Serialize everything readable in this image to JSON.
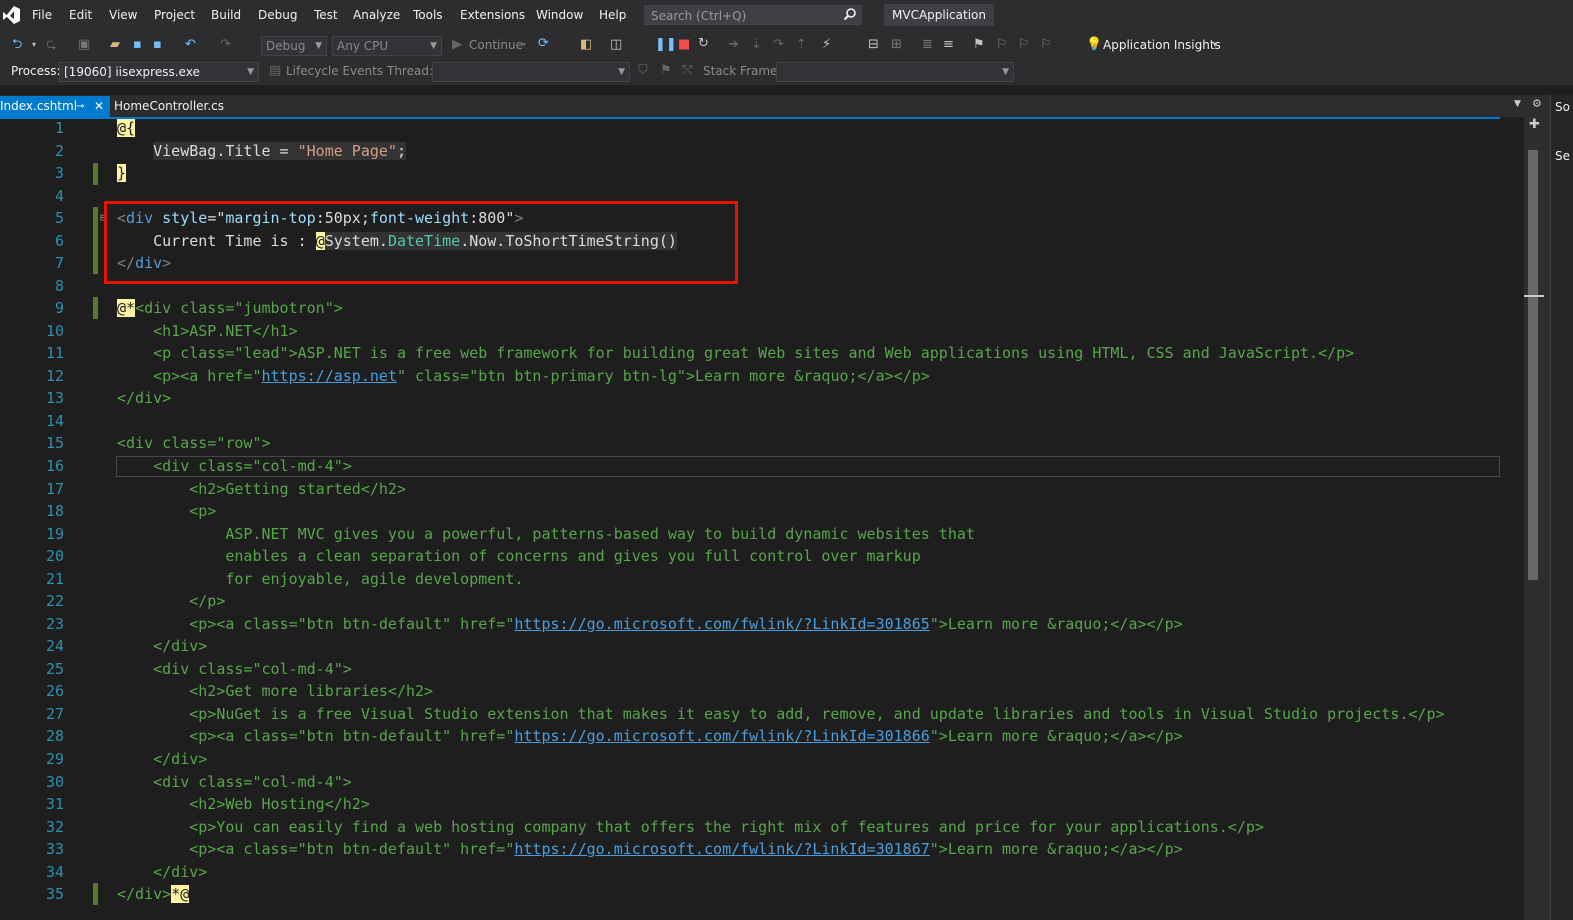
{
  "menu": [
    "File",
    "Edit",
    "View",
    "Project",
    "Build",
    "Debug",
    "Test",
    "Analyze",
    "Tools",
    "Extensions",
    "Window",
    "Help"
  ],
  "search": {
    "placeholder": "Search (Ctrl+Q)"
  },
  "app_title": "MVCApplication",
  "toolbar": {
    "config": "Debug",
    "platform": "Any CPU",
    "continue_label": "Continue",
    "app_insights": "Application Insights",
    "process_label": "Process:",
    "process_value": "[19060] iisexpress.exe",
    "lifecycle_label": "Lifecycle Events",
    "thread_label": "Thread:",
    "stack_frame_label": "Stack Frame:"
  },
  "tabs": {
    "active": "Index.cshtml",
    "inactive": "HomeController.cs"
  },
  "right_panel": {
    "top_label": "So",
    "second_label": "Se"
  },
  "editor": {
    "line_numbers": [
      "1",
      "2",
      "3",
      "4",
      "5",
      "6",
      "7",
      "8",
      "9",
      "10",
      "11",
      "12",
      "13",
      "14",
      "15",
      "16",
      "17",
      "18",
      "19",
      "20",
      "21",
      "22",
      "23",
      "24",
      "25",
      "26",
      "27",
      "28",
      "29",
      "30",
      "31",
      "32",
      "33",
      "34",
      "35"
    ],
    "t": {
      "l1a": "@",
      "l1b": "{",
      "l2a": "ViewBag.Title = ",
      "l2b": "\"Home Page\"",
      "l2c": ";",
      "l3": "}",
      "l5a": "<",
      "l5b": "div",
      "l5c": " style",
      "l5d": "=\"",
      "l5e": "margin-top",
      "l5f": ":50px;",
      "l5g": "font-weight",
      "l5h": ":800\"",
      "l5i": ">",
      "l6a": "Current Time is : ",
      "l6b": "@",
      "l6c": "System.",
      "l6d": "DateTime",
      "l6e": ".Now.ToShortTimeString()",
      "l7a": "</",
      "l7b": "div",
      "l7c": ">",
      "l9a": "@*",
      "l9b": "<div class=\"jumbotron\">",
      "l10": "    <h1>ASP.NET</h1>",
      "l11": "    <p class=\"lead\">ASP.NET is a free web framework for building great Web sites and Web applications using HTML, CSS and JavaScript.</p>",
      "l12a": "    <p><a href=\"",
      "l12b": "https://asp.net",
      "l12c": "\" class=\"btn btn-primary btn-lg\">Learn more &raquo;</a></p>",
      "l13": "</div>",
      "l15": "<div class=\"row\">",
      "l16": "    <div class=\"col-md-4\">",
      "l17": "        <h2>Getting started</h2>",
      "l18": "        <p>",
      "l19": "            ASP.NET MVC gives you a powerful, patterns-based way to build dynamic websites that",
      "l20": "            enables a clean separation of concerns and gives you full control over markup",
      "l21": "            for enjoyable, agile development.",
      "l22": "        </p>",
      "l23a": "        <p><a class=\"btn btn-default\" href=\"",
      "l23b": "https://go.microsoft.com/fwlink/?LinkId=301865",
      "l23c": "\">Learn more &raquo;</a></p>",
      "l24": "    </div>",
      "l25": "    <div class=\"col-md-4\">",
      "l26": "        <h2>Get more libraries</h2>",
      "l27": "        <p>NuGet is a free Visual Studio extension that makes it easy to add, remove, and update libraries and tools in Visual Studio projects.</p>",
      "l28a": "        <p><a class=\"btn btn-default\" href=\"",
      "l28b": "https://go.microsoft.com/fwlink/?LinkId=301866",
      "l28c": "\">Learn more &raquo;</a></p>",
      "l29": "    </div>",
      "l30": "    <div class=\"col-md-4\">",
      "l31": "        <h2>Web Hosting</h2>",
      "l32": "        <p>You can easily find a web hosting company that offers the right mix of features and price for your applications.</p>",
      "l33a": "        <p><a class=\"btn btn-default\" href=\"",
      "l33b": "https://go.microsoft.com/fwlink/?LinkId=301867",
      "l33c": "\">Learn more &raquo;</a></p>",
      "l34": "    </div>",
      "l35a": "</div>",
      "l35b": "*@"
    }
  }
}
